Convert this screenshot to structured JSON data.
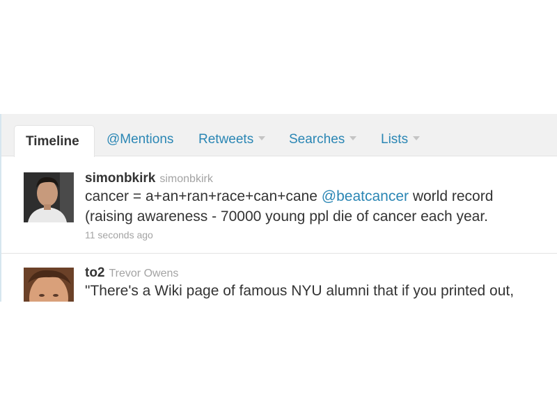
{
  "tabs": {
    "timeline": "Timeline",
    "mentions": "@Mentions",
    "retweets": "Retweets",
    "searches": "Searches",
    "lists": "Lists"
  },
  "tweets": [
    {
      "username": "simonbkirk",
      "fullname": "simonbkirk",
      "text_before": "cancer = a+an+ran+race+can+cane ",
      "mention": "@beatcancer",
      "text_after": " world record",
      "line2": "(raising awareness - 70000 young ppl die of cancer each year.",
      "time": "11 seconds ago"
    },
    {
      "username": "to2",
      "fullname": "Trevor Owens",
      "text": "\"There's a Wiki page of famous NYU alumni that if you printed out,"
    }
  ],
  "colors": {
    "link": "#2a86b4",
    "tab_bar": "#f1f1f1",
    "muted": "#a3a3a3",
    "text": "#333333"
  }
}
